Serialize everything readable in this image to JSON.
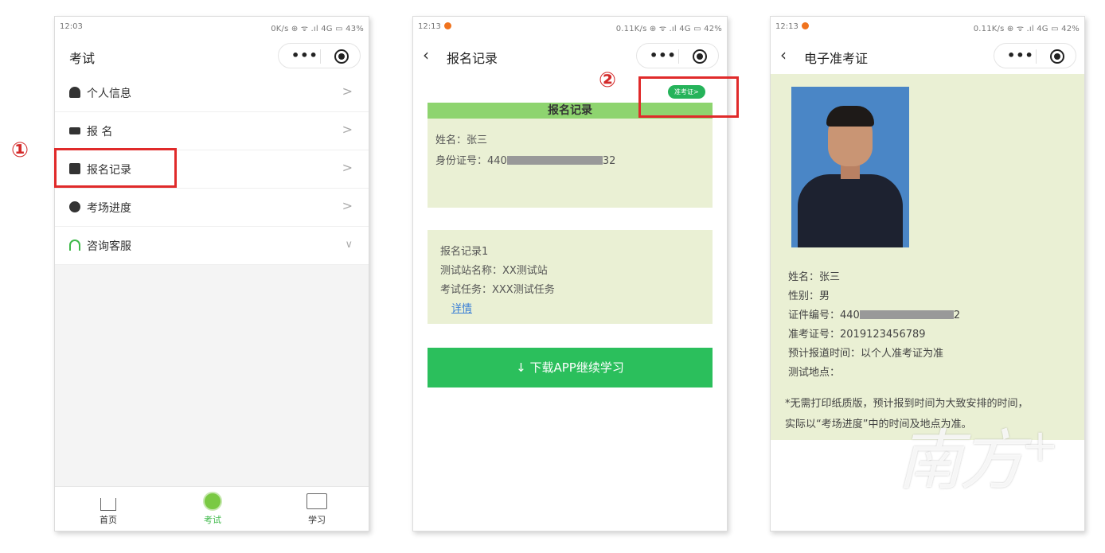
{
  "phone1": {
    "status": {
      "time": "12:03",
      "right": "0K/s ⊕ ᯤ .ıl 4G ▭ 43%"
    },
    "nav_title": "考试",
    "menu": [
      {
        "label": "个人信息",
        "icon": "person-icon"
      },
      {
        "label": "报 名",
        "icon": "ticket-icon"
      },
      {
        "label": "报名记录",
        "icon": "document-icon"
      },
      {
        "label": "考场进度",
        "icon": "clock-icon"
      },
      {
        "label": "咨询客服",
        "icon": "headset-icon"
      }
    ],
    "tabs": [
      {
        "label": "首页"
      },
      {
        "label": "考试"
      },
      {
        "label": "学习"
      }
    ],
    "step_label": "①"
  },
  "phone2": {
    "status": {
      "time": "12:13",
      "right": "0.11K/s ⊕ ᯤ .ıl 4G ▭ 42%"
    },
    "nav_title": "报名记录",
    "ticket_pill": "准考证>",
    "step_label": "②",
    "card1": {
      "header": "报名记录",
      "name_line": "姓名：张三",
      "id_prefix": "身份证号：440",
      "id_suffix": "32"
    },
    "card2": {
      "title": "报名记录1",
      "station": "测试站名称：XX测试站",
      "task": "考试任务：XXX测试任务",
      "detail_link": "详情"
    },
    "download_label": "↓ 下载APP继续学习"
  },
  "phone3": {
    "status": {
      "time": "12:13",
      "right": "0.11K/s ⊕ ᯤ .ıl 4G ▭ 42%"
    },
    "nav_title": "电子准考证",
    "fields": {
      "name": "姓名：张三",
      "gender": "性别：男",
      "cert_prefix": "证件编号：440",
      "cert_suffix": "2",
      "ticket_no": "准考证号：2019123456789",
      "arrival": "预计报道时间：以个人准考证为准",
      "location": "测试地点："
    },
    "note_line1": "*无需打印纸质版，预计报到时间为大致安排的时间，",
    "note_line2": "实际以“考场进度”中的时间及地点为准。"
  },
  "watermark": "南方+"
}
